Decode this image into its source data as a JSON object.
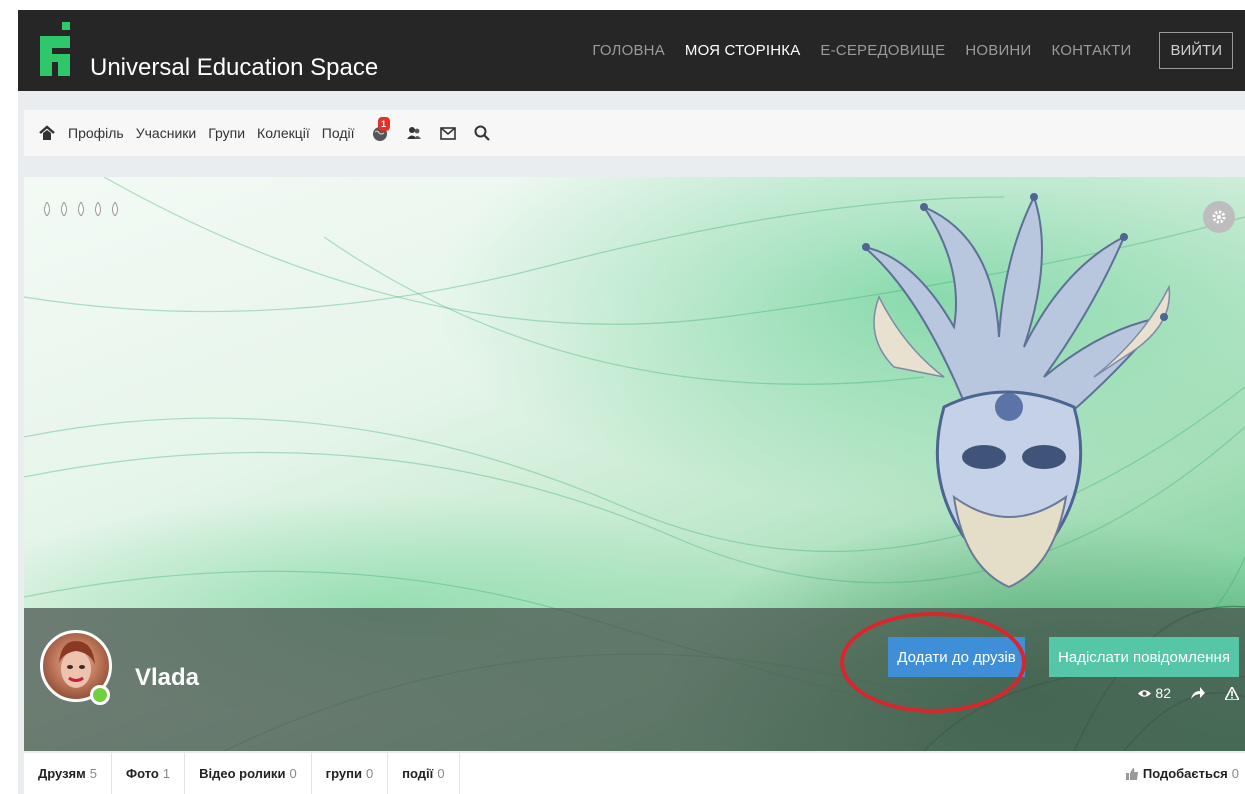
{
  "site": {
    "title": "Universal Education Space",
    "brand_color": "#2ec86a"
  },
  "main_nav": {
    "items": [
      {
        "label": "ГОЛОВНА",
        "active": false
      },
      {
        "label": "МОЯ СТОРІНКА",
        "active": true
      },
      {
        "label": "Е-СЕРЕДОВИЩЕ",
        "active": false
      },
      {
        "label": "НОВИНИ",
        "active": false
      },
      {
        "label": "КОНТАКТИ",
        "active": false
      }
    ],
    "logout_label": "ВИЙТИ"
  },
  "toolbar": {
    "home_icon": "home-icon",
    "links": [
      "Профіль",
      "Учасники",
      "Групи",
      "Колекції",
      "Події"
    ],
    "notifications_badge": "1",
    "icons": [
      "globe-notifications-icon",
      "friends-icon",
      "envelope-icon",
      "search-icon"
    ]
  },
  "cover": {
    "rating_icon": "drop-icon",
    "settings_icon": "gear-icon"
  },
  "profile": {
    "name": "Vlada",
    "status": "online",
    "add_friend_label": "Додати до друзів",
    "send_message_label": "Надіслати повідомлення",
    "views": "82",
    "colors": {
      "add_friend": "#3e8fd8",
      "send_message": "#56c6a8",
      "highlight": "#d9262c"
    }
  },
  "tabs": [
    {
      "label": "Друзям",
      "count": "5"
    },
    {
      "label": "Фото",
      "count": "1"
    },
    {
      "label": "Відео ролики",
      "count": "0"
    },
    {
      "label": "групи",
      "count": "0"
    },
    {
      "label": "події",
      "count": "0"
    }
  ],
  "likes": {
    "label": "Подобається",
    "count": "0"
  }
}
